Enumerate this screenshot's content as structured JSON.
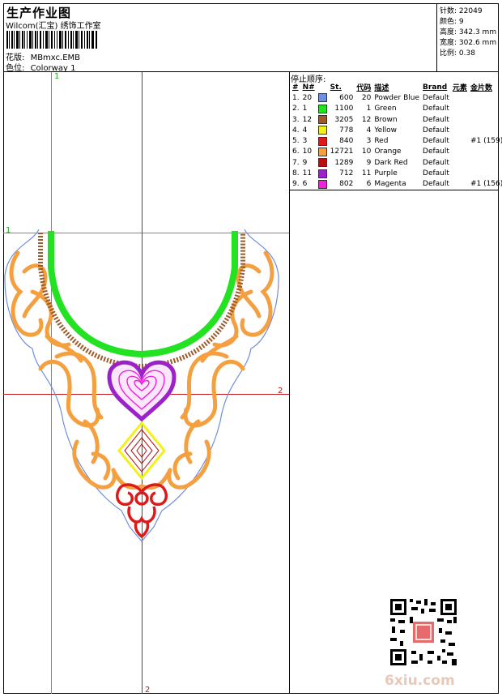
{
  "header": {
    "title": "生产作业图",
    "software": "Wilcom(汇宝) 绣饰工作室",
    "design_label": "花版:",
    "design_value": "MBmxc.EMB",
    "colorway_label": "色位:",
    "colorway_value": "Colorway 1"
  },
  "stats": {
    "stitches_label": "针数:",
    "stitches_value": "22049",
    "colors_label": "颜色:",
    "colors_value": "9",
    "height_label": "高度:",
    "height_value": "342.3 mm",
    "width_label": "宽度:",
    "width_value": "302.6 mm",
    "scale_label": "比例:",
    "scale_value": "0.38"
  },
  "sequence": {
    "title": "停止顺序:",
    "columns": [
      "#",
      "N#",
      "St.",
      "代码",
      "描述",
      "Brand",
      "元素",
      "金片数"
    ],
    "rows": [
      {
        "idx": "1.",
        "n": "20",
        "st": "600",
        "code": "20",
        "desc": "Powder Blue",
        "brand": "Default",
        "elem": "",
        "sequin": "",
        "color": "#6f8fdc"
      },
      {
        "idx": "2.",
        "n": "1",
        "st": "1100",
        "code": "1",
        "desc": "Green",
        "brand": "Default",
        "elem": "",
        "sequin": "",
        "color": "#22e222"
      },
      {
        "idx": "3.",
        "n": "12",
        "st": "3205",
        "code": "12",
        "desc": "Brown",
        "brand": "Default",
        "elem": "",
        "sequin": "",
        "color": "#9c5a2a"
      },
      {
        "idx": "4.",
        "n": "4",
        "st": "778",
        "code": "4",
        "desc": "Yellow",
        "brand": "Default",
        "elem": "",
        "sequin": "",
        "color": "#f2f21a"
      },
      {
        "idx": "5.",
        "n": "3",
        "st": "840",
        "code": "3",
        "desc": "Red",
        "brand": "Default",
        "elem": "",
        "sequin": "#1 (159)",
        "color": "#dd1a1a"
      },
      {
        "idx": "6.",
        "n": "10",
        "st": "12721",
        "code": "10",
        "desc": "Orange",
        "brand": "Default",
        "elem": "",
        "sequin": "",
        "color": "#f5a040"
      },
      {
        "idx": "7.",
        "n": "9",
        "st": "1289",
        "code": "9",
        "desc": "Dark Red",
        "brand": "Default",
        "elem": "",
        "sequin": "",
        "color": "#b81010"
      },
      {
        "idx": "8.",
        "n": "11",
        "st": "712",
        "code": "11",
        "desc": "Purple",
        "brand": "Default",
        "elem": "",
        "sequin": "",
        "color": "#9a22c8"
      },
      {
        "idx": "9.",
        "n": "6",
        "st": "802",
        "code": "6",
        "desc": "Magenta",
        "brand": "Default",
        "elem": "",
        "sequin": "#1 (156)",
        "color": "#ee22dd"
      }
    ]
  },
  "guides": {
    "top_marker": "1",
    "left_marker": "1",
    "right_marker": "2",
    "bottom_marker": "2"
  },
  "watermark": "6xiu.com"
}
